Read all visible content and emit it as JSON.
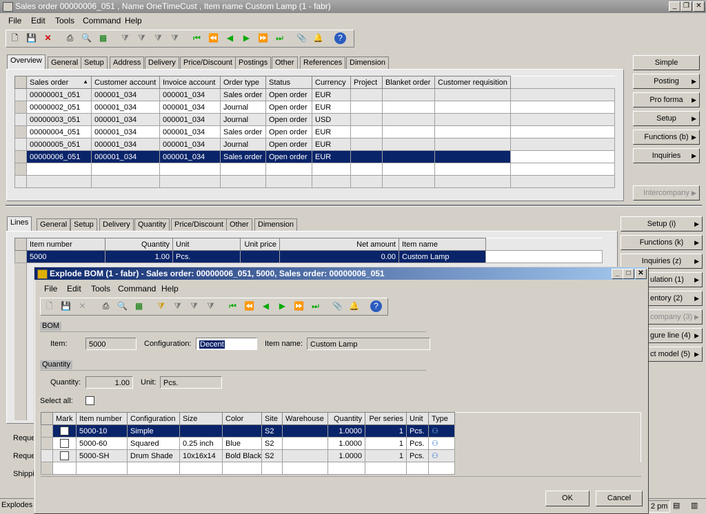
{
  "window": {
    "title": "Sales order 00000006_051 , Name OneTimeCust , Item name Custom Lamp (1 - fabr)"
  },
  "menu": [
    "File",
    "Edit",
    "Tools",
    "Command",
    "Help"
  ],
  "top_tabs": [
    "Overview",
    "General",
    "Setup",
    "Address",
    "Delivery",
    "Price/Discount",
    "Postings",
    "Other",
    "References",
    "Dimension"
  ],
  "orders": {
    "columns": [
      "Sales order",
      "Customer account",
      "Invoice account",
      "Order type",
      "Status",
      "Currency",
      "Project",
      "Blanket order",
      "Customer requisition"
    ],
    "rows": [
      [
        "00000001_051",
        "000001_034",
        "000001_034",
        "Sales order",
        "Open order",
        "EUR",
        "",
        "",
        ""
      ],
      [
        "00000002_051",
        "000001_034",
        "000001_034",
        "Journal",
        "Open order",
        "EUR",
        "",
        "",
        ""
      ],
      [
        "00000003_051",
        "000001_034",
        "000001_034",
        "Journal",
        "Open order",
        "USD",
        "",
        "",
        ""
      ],
      [
        "00000004_051",
        "000001_034",
        "000001_034",
        "Sales order",
        "Open order",
        "EUR",
        "",
        "",
        ""
      ],
      [
        "00000005_051",
        "000001_034",
        "000001_034",
        "Journal",
        "Open order",
        "EUR",
        "",
        "",
        ""
      ],
      [
        "00000006_051",
        "000001_034",
        "000001_034",
        "Sales order",
        "Open order",
        "EUR",
        "",
        "",
        ""
      ]
    ]
  },
  "right_buttons_top": [
    "Simple",
    "Posting",
    "Pro forma",
    "Setup",
    "Functions (b)",
    "Inquiries",
    "Intercompany"
  ],
  "lines_tabs": [
    "Lines",
    "General",
    "Setup",
    "Delivery",
    "Quantity",
    "Price/Discount",
    "Other",
    "Dimension"
  ],
  "lines": {
    "columns": [
      "Item number",
      "Quantity",
      "Unit",
      "Unit price",
      "Net amount",
      "Item name"
    ],
    "rows": [
      [
        "5000",
        "1.00",
        "Pcs.",
        "",
        "0.00",
        "Custom Lamp"
      ]
    ]
  },
  "right_buttons_lines": [
    "Setup (i)",
    "Functions (k)",
    "Inquiries (z)",
    "ulation (1)",
    "entory (2)",
    "company (3)",
    "gure line (4)",
    "ct model (5)"
  ],
  "left_labels": [
    "Reque",
    "Reque",
    "Shippi"
  ],
  "status": {
    "left": "Explodes",
    "time": "2 pm"
  },
  "dialog": {
    "title": "Explode BOM (1 - fabr) - Sales order: 00000006_051, 5000, Sales order: 00000006_051",
    "menu": [
      "File",
      "Edit",
      "Tools",
      "Command",
      "Help"
    ],
    "bom_group": "BOM",
    "item_label": "Item:",
    "item_value": "5000",
    "config_label": "Configuration:",
    "config_value": "Decent",
    "itemname_label": "Item name:",
    "itemname_value": "Custom Lamp",
    "qty_group": "Quantity",
    "qty_label": "Quantity:",
    "qty_value": "1.00",
    "unit_label": "Unit:",
    "unit_value": "Pcs.",
    "selectall_label": "Select all:",
    "columns": [
      "Mark",
      "Item number",
      "Configuration",
      "Size",
      "Color",
      "Site",
      "Warehouse",
      "Quantity",
      "Per series",
      "Unit",
      "Type"
    ],
    "rows": [
      [
        "",
        "5000-10",
        "Simple",
        "",
        "",
        "S2",
        "",
        "1.0000",
        "1",
        "Pcs."
      ],
      [
        "",
        "5000-60",
        "Squared",
        "0.25 inch",
        "Blue",
        "S2",
        "",
        "1.0000",
        "1",
        "Pcs."
      ],
      [
        "",
        "5000-SH",
        "Drum Shade",
        "10x16x14",
        "Bold Black",
        "S2",
        "",
        "1.0000",
        "1",
        "Pcs."
      ]
    ],
    "ok": "OK",
    "cancel": "Cancel"
  }
}
